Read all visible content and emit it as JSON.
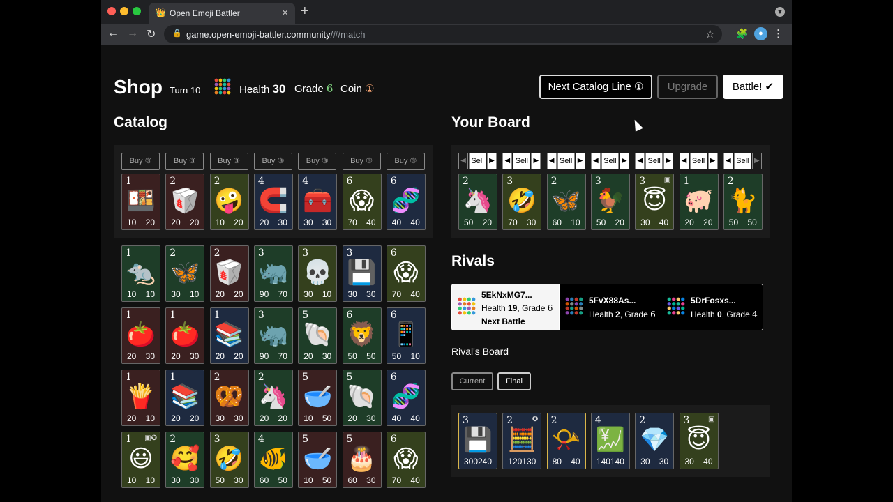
{
  "browser": {
    "tab_title": "Open Emoji Battler",
    "tab_icon": "crown-icon",
    "url_host": "game.open-emoji-battler.community",
    "url_path": "/#/match"
  },
  "header": {
    "title": "Shop",
    "turn": "Turn 10",
    "health_label": "Health",
    "health_value": "30",
    "grade_label": "Grade",
    "grade_value": "6",
    "coin_label": "Coin",
    "coin_value": "①",
    "next_catalog_line": "Next Catalog Line ①",
    "upgrade": "Upgrade",
    "battle": "Battle! ✔"
  },
  "catalog": {
    "title": "Catalog",
    "buy_label": "Buy ③",
    "top_row": [
      {
        "grade": "1",
        "emoji": "🍱",
        "attack": "10",
        "health": "20",
        "color": "#3a2020"
      },
      {
        "grade": "2",
        "emoji": "🥡",
        "attack": "20",
        "health": "20",
        "color": "#3a2020"
      },
      {
        "grade": "2",
        "emoji": "🤪",
        "attack": "10",
        "health": "20",
        "color": "#34401d"
      },
      {
        "grade": "4",
        "emoji": "🧲",
        "attack": "20",
        "health": "30",
        "color": "#1e2a40"
      },
      {
        "grade": "4",
        "emoji": "🧰",
        "attack": "30",
        "health": "30",
        "color": "#1e2a40"
      },
      {
        "grade": "6",
        "emoji": "😱",
        "attack": "70",
        "health": "40",
        "color": "#34401d"
      },
      {
        "grade": "6",
        "emoji": "🧬",
        "attack": "40",
        "health": "40",
        "color": "#1e2a40"
      }
    ],
    "grid": [
      [
        {
          "grade": "1",
          "emoji": "🐀",
          "attack": "10",
          "health": "10",
          "color": "#1e3d28"
        },
        {
          "grade": "2",
          "emoji": "🦋",
          "attack": "30",
          "health": "10",
          "color": "#1e3d28"
        },
        {
          "grade": "2",
          "emoji": "🥡",
          "attack": "20",
          "health": "20",
          "color": "#3a2020"
        },
        {
          "grade": "3",
          "emoji": "🦏",
          "attack": "90",
          "health": "70",
          "color": "#1e3d28"
        },
        {
          "grade": "3",
          "emoji": "💀",
          "attack": "30",
          "health": "10",
          "color": "#34401d"
        },
        {
          "grade": "3",
          "emoji": "💾",
          "attack": "30",
          "health": "30",
          "color": "#1e2a40"
        },
        {
          "grade": "6",
          "emoji": "😱",
          "attack": "70",
          "health": "40",
          "color": "#34401d"
        }
      ],
      [
        {
          "grade": "1",
          "emoji": "🍅",
          "attack": "20",
          "health": "30",
          "color": "#3a2020"
        },
        {
          "grade": "1",
          "emoji": "🍅",
          "attack": "20",
          "health": "30",
          "color": "#3a2020"
        },
        {
          "grade": "1",
          "emoji": "📚",
          "attack": "20",
          "health": "20",
          "color": "#1e2a40"
        },
        {
          "grade": "3",
          "emoji": "🦏",
          "attack": "90",
          "health": "70",
          "color": "#1e3d28"
        },
        {
          "grade": "5",
          "emoji": "🐚",
          "attack": "20",
          "health": "30",
          "color": "#1e3d28"
        },
        {
          "grade": "6",
          "emoji": "🦁",
          "attack": "50",
          "health": "50",
          "color": "#1e3d28"
        },
        {
          "grade": "6",
          "emoji": "📱",
          "attack": "50",
          "health": "10",
          "color": "#1e2a40"
        }
      ],
      [
        {
          "grade": "1",
          "emoji": "🍟",
          "attack": "20",
          "health": "10",
          "color": "#3a2020"
        },
        {
          "grade": "1",
          "emoji": "📚",
          "attack": "20",
          "health": "20",
          "color": "#1e2a40"
        },
        {
          "grade": "2",
          "emoji": "🥨",
          "attack": "30",
          "health": "30",
          "color": "#3a2020"
        },
        {
          "grade": "2",
          "emoji": "🦄",
          "attack": "20",
          "health": "20",
          "color": "#1e3d28"
        },
        {
          "grade": "5",
          "emoji": "🥣",
          "attack": "10",
          "health": "50",
          "color": "#3a2020"
        },
        {
          "grade": "5",
          "emoji": "🐚",
          "attack": "20",
          "health": "30",
          "color": "#1e3d28"
        },
        {
          "grade": "6",
          "emoji": "🧬",
          "attack": "40",
          "health": "40",
          "color": "#1e2a40"
        }
      ],
      [
        {
          "grade": "1",
          "emoji": "😃",
          "attack": "10",
          "health": "10",
          "color": "#34401d",
          "ability": "▣✪"
        },
        {
          "grade": "2",
          "emoji": "🥰",
          "attack": "30",
          "health": "30",
          "color": "#1e3d28"
        },
        {
          "grade": "3",
          "emoji": "🤣",
          "attack": "50",
          "health": "30",
          "color": "#34401d"
        },
        {
          "grade": "4",
          "emoji": "🐠",
          "attack": "60",
          "health": "50",
          "color": "#1e3d28"
        },
        {
          "grade": "5",
          "emoji": "🥣",
          "attack": "10",
          "health": "50",
          "color": "#3a2020"
        },
        {
          "grade": "5",
          "emoji": "🎂",
          "attack": "60",
          "health": "30",
          "color": "#3a2020"
        },
        {
          "grade": "6",
          "emoji": "😱",
          "attack": "70",
          "health": "40",
          "color": "#34401d"
        }
      ]
    ]
  },
  "board": {
    "title": "Your Board",
    "sell_label": "Sell",
    "cards": [
      {
        "grade": "2",
        "emoji": "🦄",
        "attack": "50",
        "health": "20",
        "color": "#1e3d28"
      },
      {
        "grade": "3",
        "emoji": "🤣",
        "attack": "70",
        "health": "30",
        "color": "#34401d"
      },
      {
        "grade": "2",
        "emoji": "🦋",
        "attack": "60",
        "health": "10",
        "color": "#1e3d28"
      },
      {
        "grade": "3",
        "emoji": "🐓",
        "attack": "50",
        "health": "20",
        "color": "#1e3d28"
      },
      {
        "grade": "3",
        "emoji": "😇",
        "attack": "30",
        "health": "40",
        "color": "#34401d",
        "ability": "▣"
      },
      {
        "grade": "1",
        "emoji": "🐖",
        "attack": "20",
        "health": "20",
        "color": "#1e3d28"
      },
      {
        "grade": "2",
        "emoji": "🐈",
        "attack": "50",
        "health": "50",
        "color": "#1e3d28"
      }
    ]
  },
  "rivals": {
    "title": "Rivals",
    "list": [
      {
        "name": "5EkNxMG7...",
        "health_label": "Health",
        "health": "19",
        "grade_label": "Grade",
        "grade": "6",
        "note": "Next Battle",
        "selected": true
      },
      {
        "name": "5FvX88As...",
        "health_label": "Health",
        "health": "2",
        "grade_label": "Grade",
        "grade": "6",
        "note": "",
        "selected": false
      },
      {
        "name": "5DrFosxs...",
        "health_label": "Health",
        "health": "0",
        "grade_label": "Grade",
        "grade": "4",
        "note": "",
        "selected": false
      }
    ],
    "board_title": "Rival's Board",
    "current_label": "Current",
    "final_label": "Final",
    "board": [
      {
        "grade": "3",
        "emoji": "💾",
        "attack": "300",
        "health": "240",
        "color": "#1e2a40",
        "gold": true
      },
      {
        "grade": "2",
        "emoji": "🧮",
        "attack": "120",
        "health": "130",
        "color": "#1e2a40",
        "ability": "✪"
      },
      {
        "grade": "2",
        "emoji": "📯",
        "attack": "80",
        "health": "40",
        "color": "#1e2a40",
        "gold": true
      },
      {
        "grade": "4",
        "emoji": "💹",
        "attack": "140",
        "health": "140",
        "color": "#1e2a40"
      },
      {
        "grade": "2",
        "emoji": "💎",
        "attack": "30",
        "health": "30",
        "color": "#1e2a40"
      },
      {
        "grade": "3",
        "emoji": "😇",
        "attack": "30",
        "health": "40",
        "color": "#34401d",
        "ability": "▣"
      }
    ]
  }
}
